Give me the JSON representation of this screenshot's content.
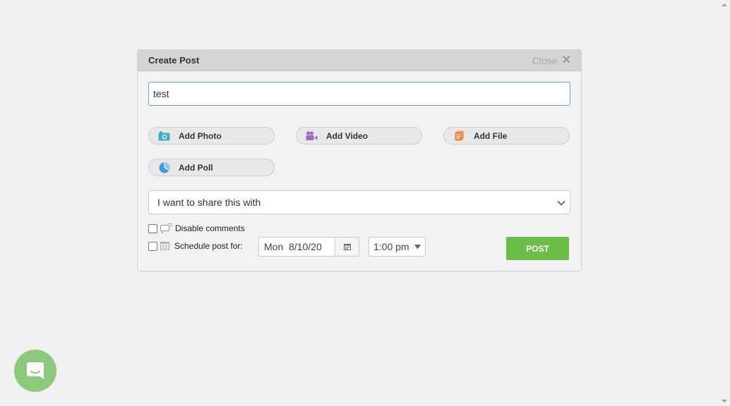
{
  "modal": {
    "title": "Create Post",
    "close_label": "Close"
  },
  "post_input": {
    "value": "test",
    "placeholder": ""
  },
  "actions": [
    {
      "label": "Add Photo",
      "icon": "camera-icon",
      "color": "#3ab0c9"
    },
    {
      "label": "Add Video",
      "icon": "video-camera-icon",
      "color": "#9b6bc4"
    },
    {
      "label": "Add File",
      "icon": "file-icon",
      "color": "#e8853a"
    },
    {
      "label": "Add Poll",
      "icon": "pie-chart-icon",
      "color": "#3a9be8"
    }
  ],
  "share": {
    "label": "I want to share this with"
  },
  "options": {
    "disable_comments_label": "Disable comments",
    "schedule_label": "Schedule post for:",
    "date_value": "Mon  8/10/20",
    "time_value": "1:00 pm"
  },
  "post_button": {
    "label": "POST",
    "color": "#6bbf47"
  },
  "chat": {
    "icon": "chat-icon",
    "color": "#8cc97a"
  }
}
